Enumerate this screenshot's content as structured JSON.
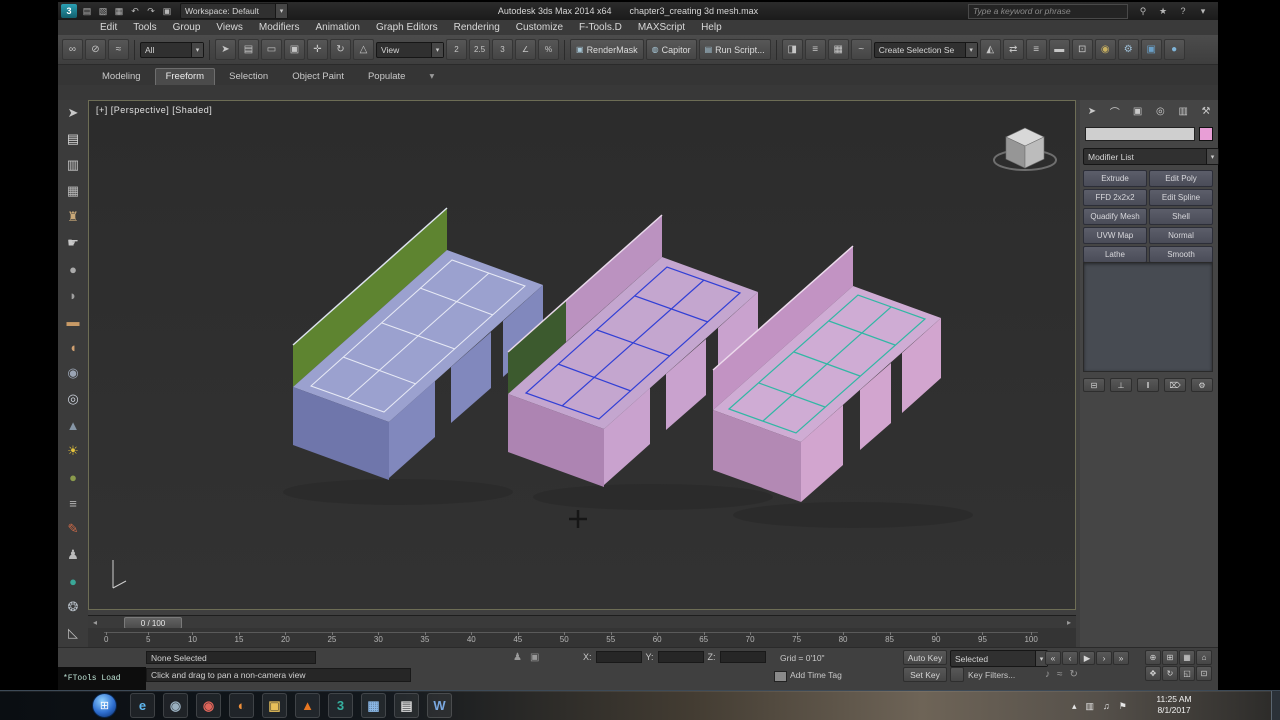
{
  "scene": {
    "colors": {
      "green_wall": "#5e8430",
      "green_dark": "#3c5a2e",
      "lavender_plan": "#9ba1cf",
      "lavender_front": "#8188bd",
      "lavender_end": "#6f76ab",
      "plan_stroke_left": "#eceef8",
      "mauve_band": "#bb92c0",
      "pink_plan_b": "#c4a6cf",
      "pink_front_b": "#c9a2ce",
      "pink_end_b": "#ad84b2",
      "plan_stroke_middle": "#2b3bd6",
      "pink_band_c": "#c293c3",
      "pink_plan_c": "#cfacd4",
      "pink_front_c": "#d2a5cf",
      "pink_end_c": "#b389b4",
      "plan_stroke_right": "#2ab8a2"
    }
  },
  "title_bar": {
    "logo": "3",
    "quick_icons": [
      {
        "name": "new-scene-icon",
        "glyph": "▤"
      },
      {
        "name": "open-file-icon",
        "glyph": "▧"
      },
      {
        "name": "save-file-icon",
        "glyph": "▦"
      },
      {
        "name": "undo-icon",
        "glyph": "↶"
      },
      {
        "name": "redo-icon",
        "glyph": "↷"
      },
      {
        "name": "project-folder-icon",
        "glyph": "▣"
      }
    ],
    "workspace_label": "Workspace: Default",
    "app_title": "Autodesk 3ds Max 2014 x64",
    "file_name": "chapter3_creating 3d mesh.max",
    "search_placeholder": "Type a keyword or phrase",
    "right_icons": [
      {
        "name": "search-icon",
        "glyph": "⚲"
      },
      {
        "name": "favorites-icon",
        "glyph": "★"
      },
      {
        "name": "help-icon",
        "glyph": "?"
      },
      {
        "name": "infocenter-dropdown-icon",
        "glyph": "▾"
      }
    ]
  },
  "menu_bar": {
    "items": [
      "Edit",
      "Tools",
      "Group",
      "Views",
      "Modifiers",
      "Animation",
      "Graph Editors",
      "Rendering",
      "Customize",
      "F-Tools.D",
      "MAXScript",
      "Help"
    ]
  },
  "toolbar": {
    "icons_a": [
      {
        "name": "select-and-link-icon",
        "glyph": "∞"
      },
      {
        "name": "unlink-selection-icon",
        "glyph": "⊘"
      },
      {
        "name": "bind-to-space-warp-icon",
        "glyph": "≈"
      }
    ],
    "select_filter_value": "All",
    "icons_b": [
      {
        "name": "select-object-icon",
        "glyph": "➤"
      },
      {
        "name": "select-by-name-icon",
        "glyph": "▤"
      },
      {
        "name": "rectangular-region-icon",
        "glyph": "▭"
      },
      {
        "name": "window-crossing-icon",
        "glyph": "▣"
      },
      {
        "name": "select-and-move-icon",
        "glyph": "✛"
      },
      {
        "name": "select-and-rotate-icon",
        "glyph": "↻"
      },
      {
        "name": "select-and-scale-icon",
        "glyph": "△"
      }
    ],
    "coord_system_value": "View",
    "icons_c": [
      {
        "name": "snap-toggle-2d-icon",
        "glyph": "2"
      },
      {
        "name": "snap-toggle-25d-icon",
        "glyph": "2.5"
      },
      {
        "name": "snap-toggle-3d-icon",
        "glyph": "3"
      },
      {
        "name": "angle-snap-icon",
        "glyph": "∠"
      },
      {
        "name": "percent-snap-icon",
        "glyph": "%"
      }
    ],
    "render_mask_label": "RenderMask",
    "capitor_label": "Capitor",
    "run_script_label": "Run Script...",
    "icons_d": [
      {
        "name": "mirror-icon",
        "glyph": "◨"
      },
      {
        "name": "align-icon",
        "glyph": "≡"
      },
      {
        "name": "layer-manager-icon",
        "glyph": "▦"
      },
      {
        "name": "curve-editor-icon",
        "glyph": "~"
      }
    ],
    "selection_set_value": "Create Selection Se",
    "icons_e": [
      {
        "name": "named-selection-icon",
        "glyph": "◭"
      },
      {
        "name": "mirror-tool-icon",
        "glyph": "⇄"
      },
      {
        "name": "align-tool-icon",
        "glyph": "≡"
      },
      {
        "name": "toggle-ribbon-icon",
        "glyph": "▬"
      },
      {
        "name": "schematic-view-icon",
        "glyph": "⊡"
      },
      {
        "name": "material-editor-icon",
        "glyph": "◉",
        "color": "#c8b060"
      },
      {
        "name": "render-setup-icon",
        "glyph": "⚙",
        "color": "#9fc0d8"
      },
      {
        "name": "rendered-frame-icon",
        "glyph": "▣",
        "color": "#6aa0c8"
      },
      {
        "name": "render-production-icon",
        "glyph": "●",
        "color": "#7fb4d8"
      }
    ]
  },
  "ribbon": {
    "tabs": [
      "Modeling",
      "Freeform",
      "Selection",
      "Object Paint",
      "Populate"
    ]
  },
  "left_toolbar": {
    "icons": [
      {
        "name": "select-arrow-icon",
        "glyph": "➤",
        "color": "#c8c8c8"
      },
      {
        "name": "document-icon",
        "glyph": "▤",
        "color": "#d8d8d8"
      },
      {
        "name": "clipboard-icon",
        "glyph": "▥",
        "color": "#c8c8c8"
      },
      {
        "name": "grid-icon",
        "glyph": "▦",
        "color": "#b8b8b8"
      },
      {
        "name": "chair-icon",
        "glyph": "♜",
        "color": "#c8a878"
      },
      {
        "name": "hand-icon",
        "glyph": "☛",
        "color": "#c8c8c8"
      },
      {
        "name": "sphere-icon",
        "glyph": "●",
        "color": "#aaaaaa"
      },
      {
        "name": "dome-icon",
        "glyph": "◗",
        "color": "#a0a0a0"
      },
      {
        "name": "sofa-icon",
        "glyph": "▬",
        "color": "#c89a66"
      },
      {
        "name": "cushion-icon",
        "glyph": "◖",
        "color": "#d0a070"
      },
      {
        "name": "shaded-sphere-icon",
        "glyph": "◉",
        "color": "#9aa4b4"
      },
      {
        "name": "eye-icon",
        "glyph": "◎",
        "color": "#ccd2dc"
      },
      {
        "name": "cone-icon",
        "glyph": "▲",
        "color": "#8696a6"
      },
      {
        "name": "sun-icon",
        "glyph": "☀",
        "color": "#e6c43c"
      },
      {
        "name": "olive-ball-icon",
        "glyph": "●",
        "color": "#8a9a4c"
      },
      {
        "name": "layers-icon",
        "glyph": "≡",
        "color": "#b4b4b4"
      },
      {
        "name": "pencil-icon",
        "glyph": "✎",
        "color": "#cc6a48"
      },
      {
        "name": "figure-icon",
        "glyph": "♟",
        "color": "#bcbcbc"
      },
      {
        "name": "teal-ball-icon",
        "glyph": "●",
        "color": "#3aa898"
      },
      {
        "name": "spiral-icon",
        "glyph": "❂",
        "color": "#b4bcc4"
      },
      {
        "name": "protractor-icon",
        "glyph": "◺",
        "color": "#bcbcbc"
      }
    ]
  },
  "viewport": {
    "label": "[+] [Perspective] [Shaded]"
  },
  "command_panel": {
    "tab_icons": [
      {
        "name": "create-tab-icon",
        "glyph": "➤"
      },
      {
        "name": "modify-tab-icon",
        "glyph": "⌒"
      },
      {
        "name": "hierarchy-tab-icon",
        "glyph": "▣"
      },
      {
        "name": "motion-tab-icon",
        "glyph": "◎"
      },
      {
        "name": "display-tab-icon",
        "glyph": "▥"
      },
      {
        "name": "utilities-tab-icon",
        "glyph": "⚒"
      }
    ],
    "object_color": "#e89ed6",
    "modifier_list_label": "Modifier List",
    "modifier_buttons": [
      "Extrude",
      "Edit Poly",
      "FFD 2x2x2",
      "Edit Spline",
      "Quadify Mesh",
      "Shell",
      "UVW Map",
      "Normal",
      "Lathe",
      "Smooth"
    ],
    "stack_buttons": [
      {
        "name": "pin-stack-icon",
        "glyph": "⊟"
      },
      {
        "name": "show-end-result-icon",
        "glyph": "⊥"
      },
      {
        "name": "make-unique-icon",
        "glyph": "‖"
      },
      {
        "name": "remove-modifier-icon",
        "glyph": "⌦"
      },
      {
        "name": "configure-sets-icon",
        "glyph": "⚙"
      }
    ]
  },
  "timeline": {
    "slider_value": "0 / 100",
    "ticks": [
      "0",
      "5",
      "10",
      "15",
      "20",
      "25",
      "30",
      "35",
      "40",
      "45",
      "50",
      "55",
      "60",
      "65",
      "70",
      "75",
      "80",
      "85",
      "90",
      "95",
      "100"
    ]
  },
  "status_bar": {
    "ftools_label": "*FTools Load",
    "selection_status": "None Selected",
    "prompt": "Click and drag to pan a non-camera view",
    "status_icons": [
      {
        "name": "selection-lock-icon",
        "glyph": "♟"
      },
      {
        "name": "absolute-mode-icon",
        "glyph": "▣"
      }
    ],
    "x_label": "X:",
    "y_label": "Y:",
    "z_label": "Z:",
    "grid_label": "Grid = 0'10\"",
    "add_time_tag_label": "Add Time Tag",
    "auto_key_label": "Auto Key",
    "set_key_label": "Set Key",
    "selected_value": "Selected",
    "key_filters_label": "Key Filters...",
    "transport": [
      {
        "name": "go-to-start-icon",
        "glyph": "«"
      },
      {
        "name": "previous-frame-icon",
        "glyph": "‹"
      },
      {
        "name": "play-icon",
        "glyph": "▶"
      },
      {
        "name": "next-frame-icon",
        "glyph": "›"
      },
      {
        "name": "go-to-end-icon",
        "glyph": "»"
      }
    ],
    "extra_icons": [
      {
        "name": "sound-toggle-icon",
        "glyph": "♪"
      },
      {
        "name": "realtime-icon",
        "glyph": "≈"
      },
      {
        "name": "loop-icon",
        "glyph": "↻"
      }
    ],
    "nav_buttons": [
      {
        "name": "zoom-icon",
        "glyph": "⊕"
      },
      {
        "name": "zoom-all-icon",
        "glyph": "⊞"
      },
      {
        "name": "zoom-extents-icon",
        "glyph": "▦"
      },
      {
        "name": "zoom-extents-all-icon",
        "glyph": "⌂"
      },
      {
        "name": "pan-icon",
        "glyph": "✥"
      },
      {
        "name": "orbit-icon",
        "glyph": "↻"
      },
      {
        "name": "fov-icon",
        "glyph": "◱"
      },
      {
        "name": "maximize-viewport-icon",
        "glyph": "⊡"
      }
    ]
  },
  "taskbar": {
    "start_glyph": "⊞",
    "icons": [
      {
        "name": "internet-explorer-icon",
        "glyph": "e",
        "color": "#5fb8f0"
      },
      {
        "name": "media-player-icon",
        "glyph": "◉",
        "color": "#9ab0c0"
      },
      {
        "name": "chrome-icon",
        "glyph": "◉",
        "color": "#e0655a"
      },
      {
        "name": "firefox-icon",
        "glyph": "◐",
        "color": "#ef8f3a"
      },
      {
        "name": "explorer-folder-icon",
        "glyph": "▣",
        "color": "#e8c05a"
      },
      {
        "name": "vlc-icon",
        "glyph": "▲",
        "color": "#e87722"
      },
      {
        "name": "3dsmax-icon",
        "glyph": "3",
        "color": "#35b0a0"
      },
      {
        "name": "photo-viewer-icon",
        "glyph": "▦",
        "color": "#8ab8e8"
      },
      {
        "name": "notepad-icon",
        "glyph": "▤",
        "color": "#d8d8d8"
      },
      {
        "name": "word-icon",
        "glyph": "W",
        "color": "#7aa8e0"
      }
    ],
    "tray_icons": [
      {
        "name": "tray-expand-icon",
        "glyph": "▴"
      },
      {
        "name": "tray-display-icon",
        "glyph": "▥"
      },
      {
        "name": "tray-volume-icon",
        "glyph": "♫"
      },
      {
        "name": "tray-flag-icon",
        "glyph": "⚑"
      }
    ],
    "time": "11:25 AM",
    "date": "8/1/2017"
  }
}
